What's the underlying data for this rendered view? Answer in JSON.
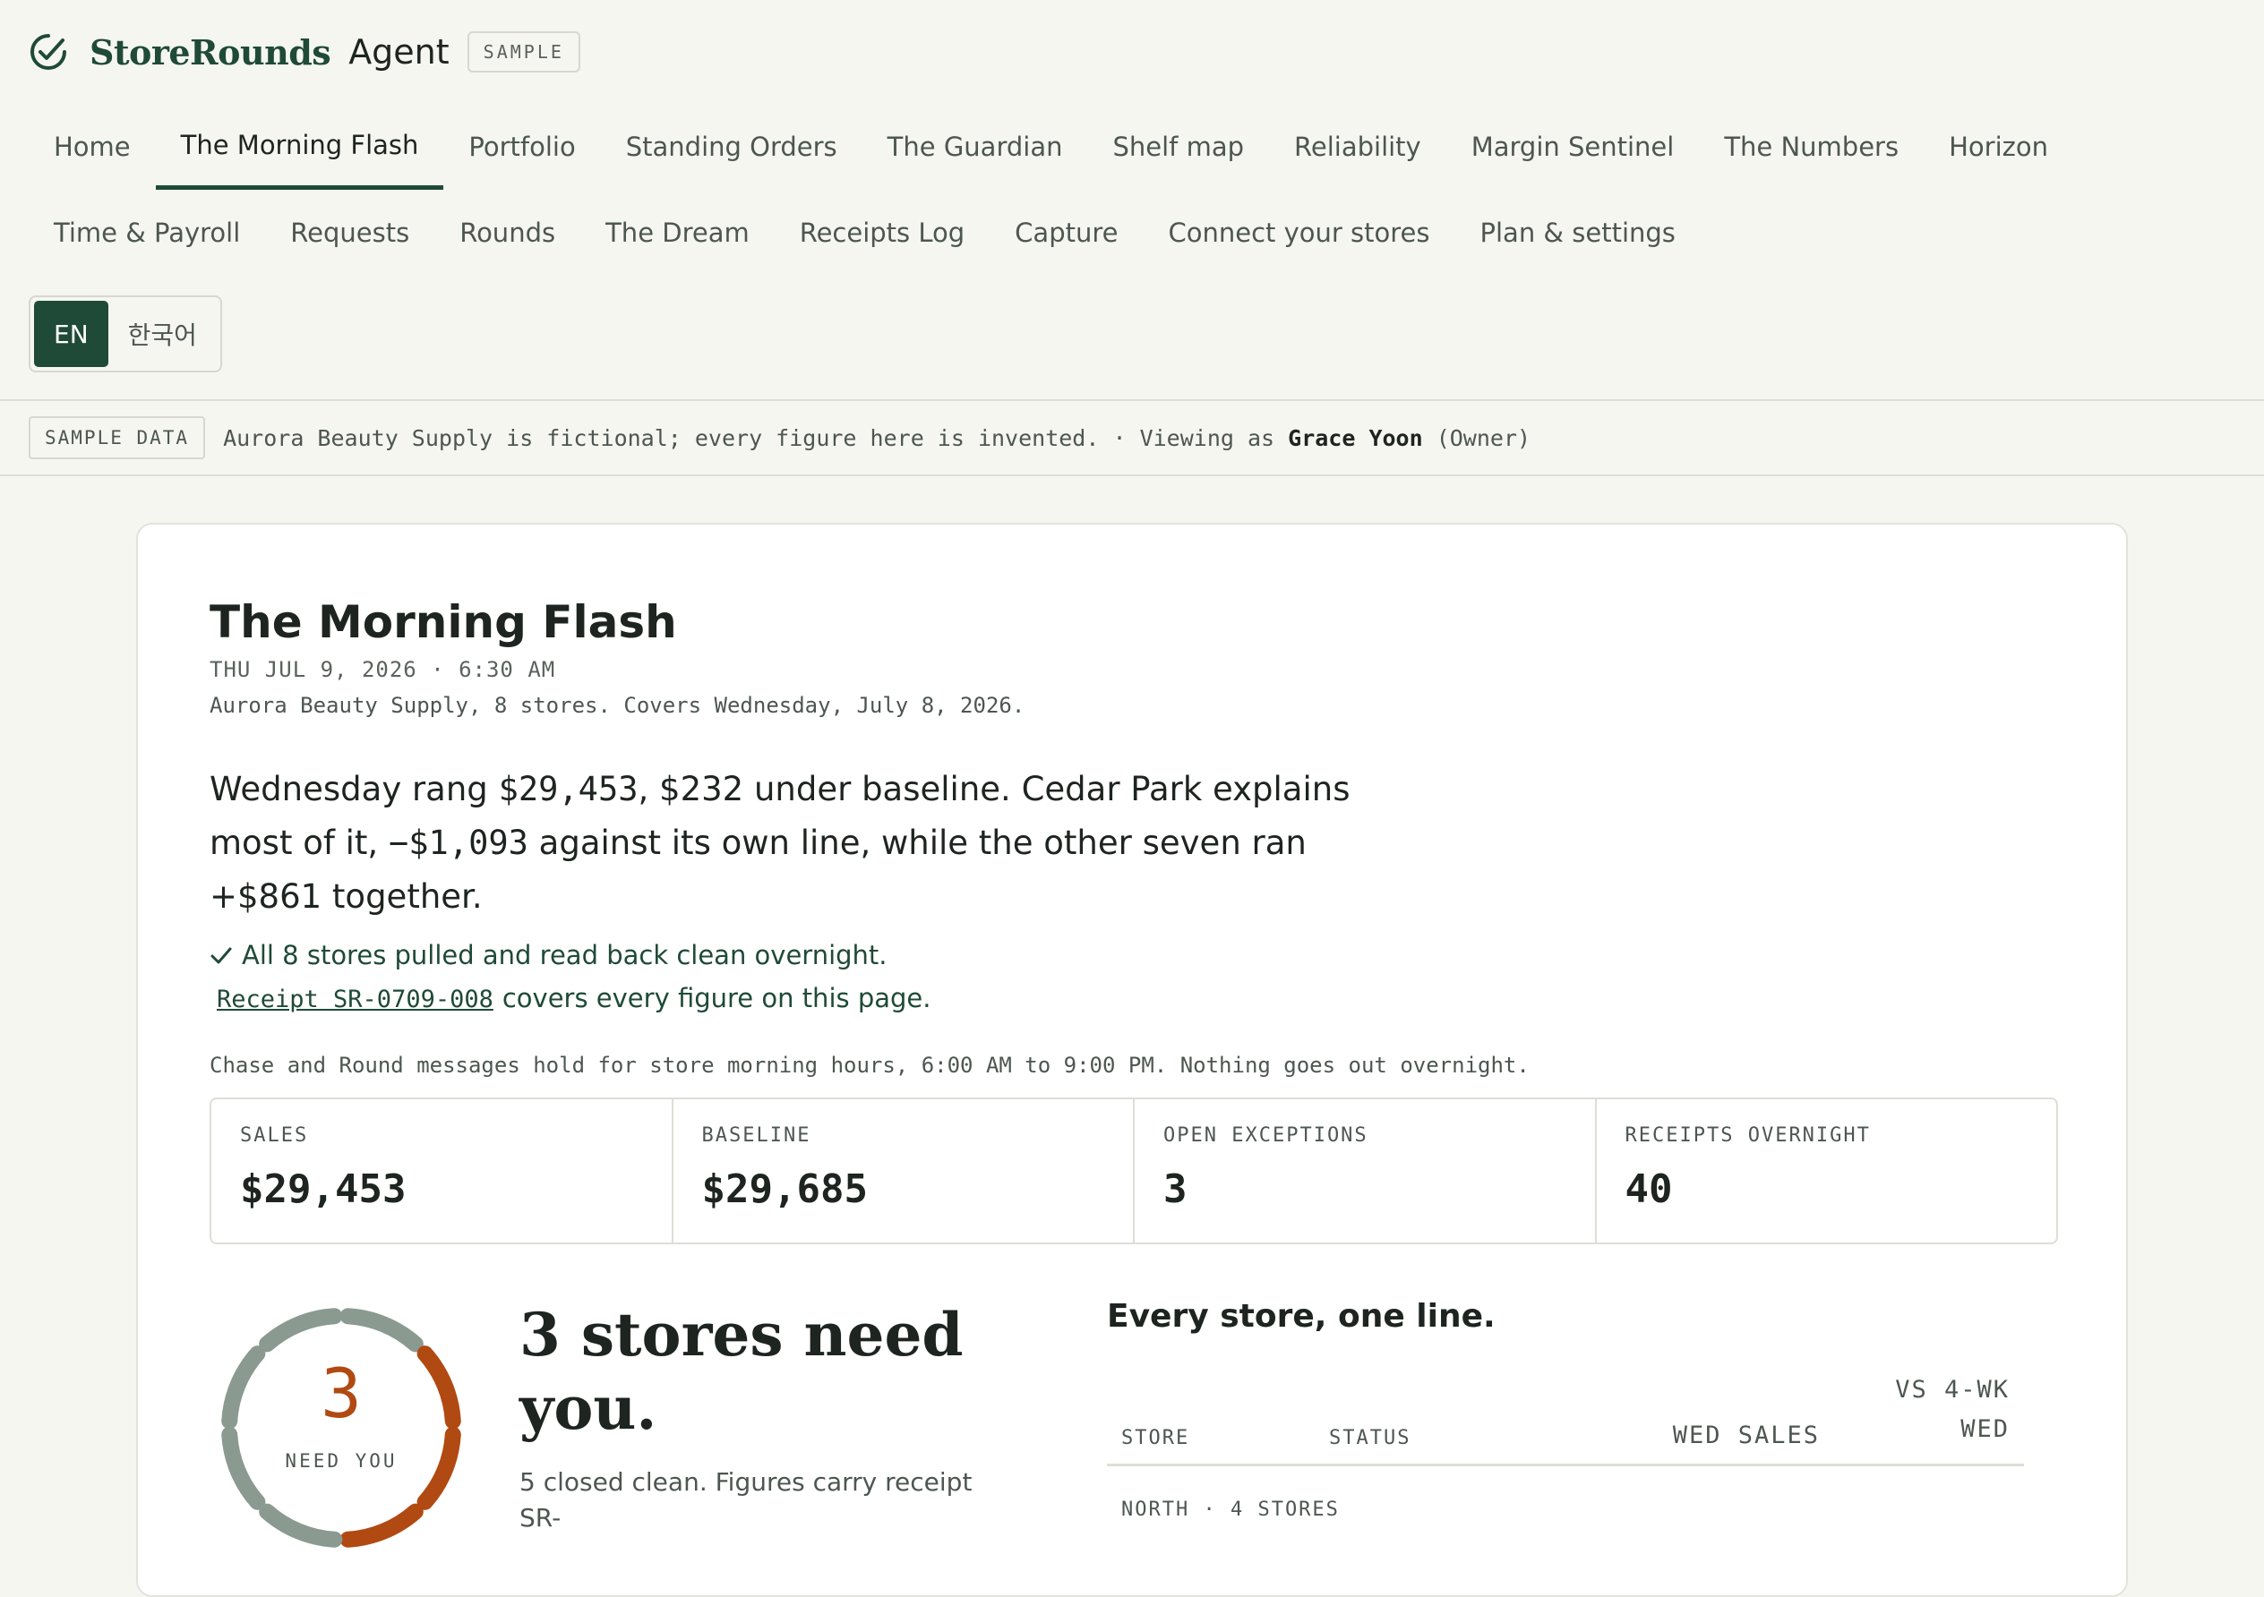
{
  "brand": {
    "name": "StoreRounds",
    "suffix": "Agent",
    "tag": "SAMPLE"
  },
  "nav": {
    "row1": [
      "Home",
      "The Morning Flash",
      "Portfolio",
      "Standing Orders",
      "The Guardian",
      "Shelf map",
      "Reliability",
      "Margin Sentinel",
      "The Numbers",
      "Horizon"
    ],
    "row2": [
      "Time & Payroll",
      "Requests",
      "Rounds",
      "The Dream",
      "Receipts Log",
      "Capture",
      "Connect your stores",
      "Plan & settings"
    ],
    "active": "The Morning Flash"
  },
  "lang": {
    "en": "EN",
    "ko": "한국어",
    "selected": "EN"
  },
  "sample_bar": {
    "tag": "SAMPLE DATA",
    "text": "Aurora Beauty Supply is fictional; every figure here is invented.",
    "sep": " · Viewing as ",
    "user": "Grace Yoon",
    "role": " (Owner)"
  },
  "flash": {
    "title": "The Morning Flash",
    "dateline": "THU JUL 9, 2026 · 6:30 AM",
    "cover": "Aurora Beauty Supply, 8 stores. Covers Wednesday, July 8, 2026.",
    "lede": {
      "p1": "Wednesday rang ",
      "n1": "$29,453",
      "p2": ", $232 under baseline. Cedar Park explains most of it, ",
      "n2": "−$1,093",
      "p3": " against its own line, while the other seven ran +$861 together."
    },
    "ok": "All 8 stores pulled and read back clean overnight.",
    "receipt_id": "Receipt SR-0709-008",
    "receipt_text": "covers every figure on this page.",
    "hold": "Chase and Round messages hold for store morning hours, 6:00 AM to 9:00 PM. Nothing goes out overnight."
  },
  "kpis": [
    {
      "label": "SALES",
      "value": "$29,453"
    },
    {
      "label": "BASELINE",
      "value": "$29,685"
    },
    {
      "label": "OPEN EXCEPTIONS",
      "value": "3"
    },
    {
      "label": "RECEIPTS OVERNIGHT",
      "value": "40"
    }
  ],
  "need": {
    "count": "3",
    "count_label": "NEED YOU",
    "total": 8,
    "flagged": 3,
    "title": "3 stores need you.",
    "sub": "5 closed clean. Figures carry receipt SR-"
  },
  "stores_table": {
    "title": "Every store, one line.",
    "headers": {
      "store": "STORE",
      "status": "STATUS",
      "sales": "WED SALES",
      "vs1": "VS 4-WK",
      "vs2": "WED"
    },
    "group": "NORTH · 4 STORES"
  },
  "colors": {
    "brand": "#1f4a38",
    "alert": "#b04a12",
    "clean": "#8a9a90"
  },
  "icons": {
    "brand": "check-circle-icon",
    "ok": "check-icon"
  }
}
